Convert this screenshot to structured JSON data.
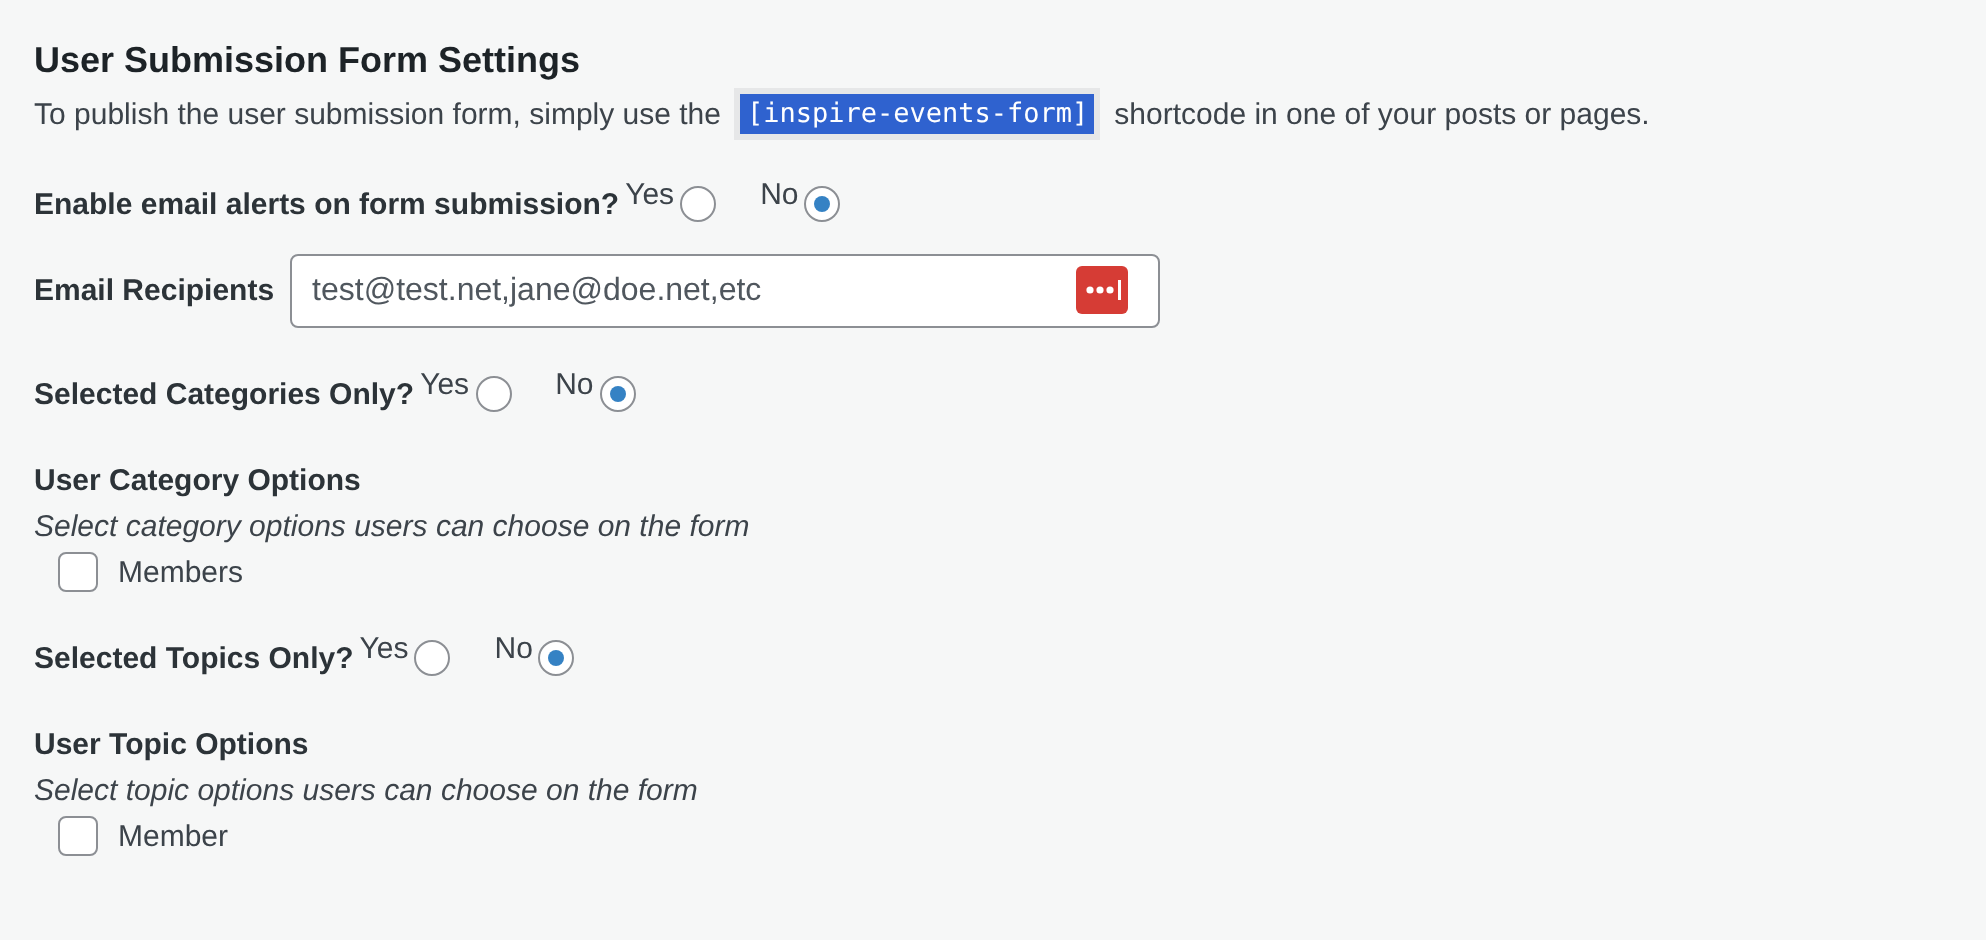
{
  "title": "User Submission Form Settings",
  "intro": {
    "before": "To publish the user submission form, simply use the",
    "code": "[inspire-events-form]",
    "after": "shortcode in one of your posts or pages."
  },
  "sections": [
    {
      "kind": "radio",
      "label": "Enable email alerts on form submission?",
      "options": [
        {
          "label": "Yes",
          "selected": false
        },
        {
          "label": "No",
          "selected": true
        }
      ]
    },
    {
      "kind": "email",
      "label": "Email Recipients",
      "placeholder": "test@test.net,jane@doe.net,etc"
    },
    {
      "kind": "radio",
      "label": "Selected Categories Only?",
      "options": [
        {
          "label": "Yes",
          "selected": false
        },
        {
          "label": "No",
          "selected": true
        }
      ]
    },
    {
      "kind": "options",
      "label": "User Category Options",
      "description": "Select category options users can choose on the form",
      "items": [
        {
          "label": "Members",
          "checked": false
        }
      ]
    },
    {
      "kind": "radio",
      "label": "Selected Topics Only?",
      "options": [
        {
          "label": "Yes",
          "selected": false
        },
        {
          "label": "No",
          "selected": true
        }
      ]
    },
    {
      "kind": "options",
      "label": "User Topic Options",
      "description": "Select topic options users can choose on the form",
      "items": [
        {
          "label": "Member",
          "checked": false
        }
      ]
    }
  ]
}
